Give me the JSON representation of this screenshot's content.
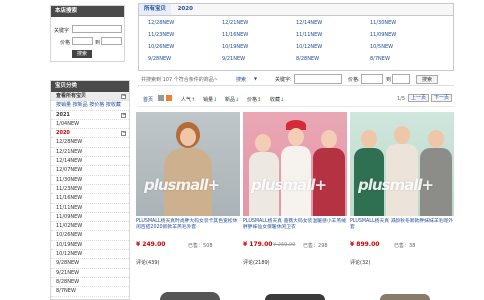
{
  "search_box": {
    "title": "本店搜索",
    "keyword_label": "关键字",
    "price_label": "价格",
    "price_sep": "到",
    "search_button": "搜索"
  },
  "categories": {
    "title": "宝贝分类",
    "view_all": "查看所有宝贝",
    "sort_links": [
      "按销量",
      "按新品",
      "按价格",
      "按收藏"
    ],
    "year_2021": "2021",
    "items_2021": [
      "1/04NEW"
    ],
    "year_2020": "2020",
    "items_2020": [
      "12/28NEW",
      "12/21NEW",
      "12/14NEW",
      "12/07NEW",
      "11/30NEW",
      "11/23NEW",
      "11/16NEW",
      "11/11NEW",
      "11/09NEW",
      "11/02NEW",
      "10/26NEW",
      "10/19NEW",
      "10/12NEW",
      "9/28NEW",
      "9/21NEW",
      "8/28NEW",
      "8/7NEW"
    ]
  },
  "main": {
    "tabs": [
      "所有宝贝",
      "2020"
    ],
    "grid": [
      [
        "12/28NEW",
        "12/21NEW",
        "12/14NEW",
        "11/30NEW"
      ],
      [
        "11/23NEW",
        "11/16NEW",
        "11/11NEW",
        "11/09NEW"
      ],
      [
        "10/26NEW",
        "10/19NEW",
        "10/12NEW",
        "10/5NEW"
      ],
      [
        "9/28NEW",
        "9/21NEW",
        "8/28NEW",
        "8/7NEW"
      ]
    ],
    "filter_text": "共搜索到 107 个符合条件的商品~",
    "search_label": "搜索",
    "keyword_label": "关键字:",
    "price_label": "价格:",
    "price_sep": "到",
    "search_button": "搜索",
    "sort_first": "首页",
    "sort_items": [
      "人气",
      "销量",
      "新品",
      "价格",
      "收藏"
    ],
    "page_indicator": "1/5",
    "prev_button": "上一页",
    "next_button": "下一页"
  },
  "products": [
    {
      "title": "PLUSMALL杨天真时尚胖大码女装卡其色宽松休闲百搭2020新款羊羔毛外套",
      "price": "¥ 249.00",
      "old_price": "",
      "sold": "已售：",
      "sold_count": "508",
      "review": "评论(439)",
      "logo": "plusmall+"
    },
    {
      "title": "PLUSMALL杨天真 蔷薇大码女装温暖感小羊羔绒胖胖妹仙女保暖休闲卫衣",
      "price": "¥ 179.00",
      "old_price": "¥ 269.00",
      "sold": "已售：",
      "sold_count": "298",
      "review": "评论(2189)",
      "logo": "plusmall+"
    },
    {
      "title": "PLUSMALL杨天真 减龄秋冬新款胖妹妹羊毛呢外套",
      "price": "¥ 899.00",
      "old_price": "",
      "sold": "已售：",
      "sold_count": "38",
      "review": "评论(32)",
      "logo": "plusmall+"
    }
  ]
}
